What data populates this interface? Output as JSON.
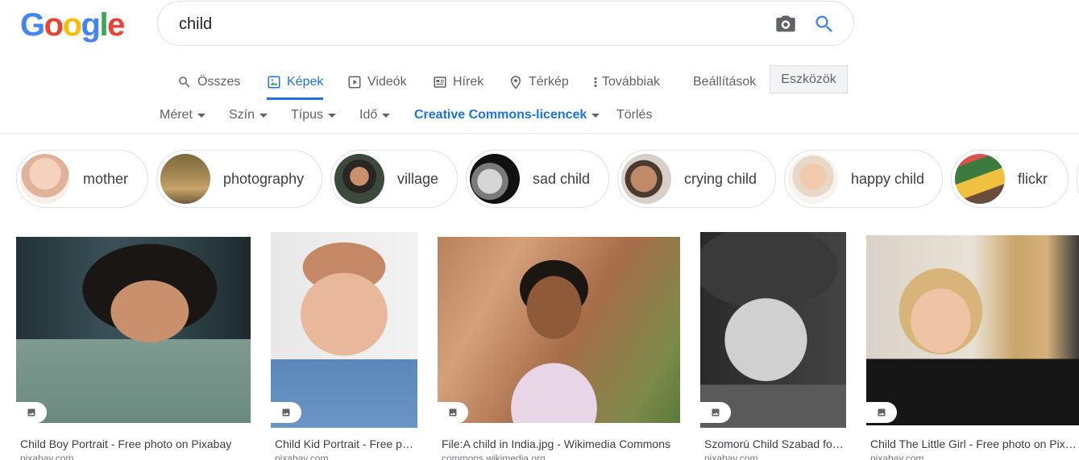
{
  "header": {
    "logo_letters": [
      "G",
      "o",
      "o",
      "g",
      "l",
      "e"
    ],
    "logo_colors": [
      "#4285F4",
      "#EA4335",
      "#FBBC05",
      "#4285F4",
      "#34A853",
      "#EA4335"
    ],
    "search_value": "child"
  },
  "tabs": [
    {
      "label": "Összes",
      "icon": "search-icon"
    },
    {
      "label": "Képek",
      "icon": "image-icon",
      "active": true
    },
    {
      "label": "Videók",
      "icon": "video-icon"
    },
    {
      "label": "Hírek",
      "icon": "news-icon"
    },
    {
      "label": "Térkép",
      "icon": "map-pin-icon"
    },
    {
      "label": "Továbbiak",
      "icon": "more-vert-icon"
    }
  ],
  "settings_label": "Beállítások",
  "tools_label": "Eszközök",
  "filters": [
    {
      "label": "Méret"
    },
    {
      "label": "Szín"
    },
    {
      "label": "Típus"
    },
    {
      "label": "Idő"
    },
    {
      "label": "Creative Commons-licencek",
      "active": true
    },
    {
      "label": "Törlés",
      "no_caret": true
    }
  ],
  "chips": [
    {
      "label": "mother"
    },
    {
      "label": "photography"
    },
    {
      "label": "village"
    },
    {
      "label": "sad child"
    },
    {
      "label": "crying child"
    },
    {
      "label": "happy child"
    },
    {
      "label": "flickr"
    }
  ],
  "results": [
    {
      "title": "Child Boy Portrait - Free photo on Pixabay",
      "source": "pixabay.com"
    },
    {
      "title": "Child Kid Portrait - Free photo on Pixabay",
      "source": "pixabay.com"
    },
    {
      "title": "File:A child in India.jpg - Wikimedia Commons",
      "source": "commons.wikimedia.org"
    },
    {
      "title": "Szomorú Child Szabad fotó a Pixabay-en",
      "source": "pixabay.com"
    },
    {
      "title": "Child The Little Girl - Free photo on Pixabay",
      "source": "pixabay.com"
    }
  ],
  "colors": {
    "accent": "#1a73e8",
    "text_muted": "#5f6368"
  }
}
